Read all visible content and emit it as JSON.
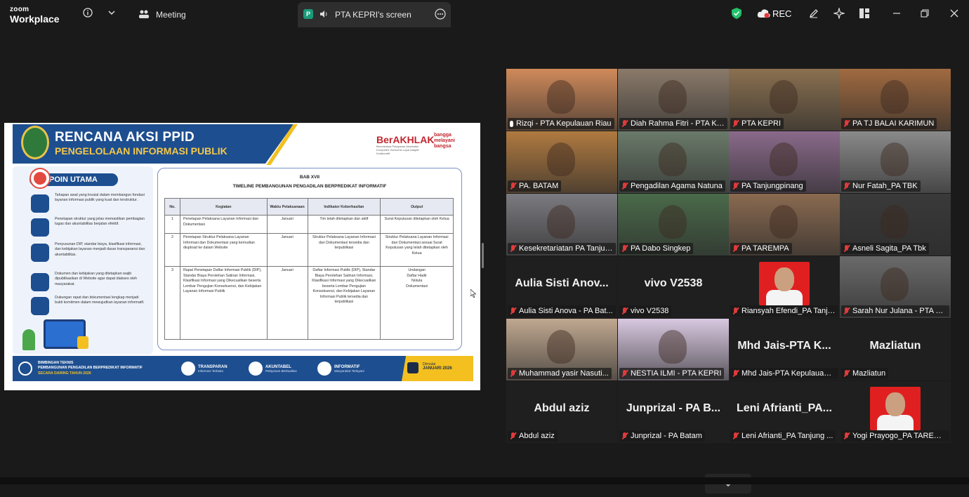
{
  "app": {
    "brand_small": "zoom",
    "brand_big": "Workplace",
    "meeting_label": "Meeting",
    "share_label": "PTA KEPRI's screen",
    "share_badge": "P",
    "rec_label": "REC"
  },
  "slide": {
    "title1": "RENCANA AKSI PPID",
    "title2": "PENGELOLAAN INFORMASI PUBLIK",
    "berakhlak": "BerAKHLAK",
    "berakhlak_sub": "Berorientasi Pelayanan Akuntabel Kompeten Harmonis Loyal Adaptif Kolaboratif",
    "bangga": "bangga melayani bangsa",
    "poin_title": "POIN UTAMA",
    "poin_items": [
      "Tahapan awal yang krusial dalam membangun fondasi layanan informasi publik yang kuat dan terstruktur.",
      "Penetapan struktur yang jelas memastikan pembagian tugas dan akuntabilitas berjalan efektif.",
      "Penyusunan DIP, standar biaya, klasifikasi informasi, dan kebijakan layanan menjadi dasar transparansi dan akuntabilitas.",
      "Dokumen dan kebijakan yang ditetapkan wajib dipublikasikan di Website agar dapat diakses oleh masyarakat.",
      "Dukungan rapat dan dokumentasi lengkap menjadi bukti komitmen dalam mewujudkan layanan informatif."
    ],
    "bab": "BAB XVII",
    "timeline_title": "TIMELINE PEMBANGUNAN PENGADILAN BERPREDIKAT INFORMATIF",
    "headers": [
      "No.",
      "Kegiatan",
      "Waktu Pelaksanaan",
      "Indikator Keberhasilan",
      "Output"
    ],
    "rows": [
      {
        "no": "1",
        "kegiatan": "Penetapan Pelaksana Layanan Informasi dan Dokumentasi",
        "waktu": "Januari",
        "indikator": "Tim telah ditetapkan dan aktif",
        "output": "Surat Keputusan ditetapkan oleh Ketua"
      },
      {
        "no": "2",
        "kegiatan": "Penetapan Struktur Pelaksana Layanan Informasi dan Dokumentasi yang kemudian diupload ke dalam Website",
        "waktu": "Januari",
        "indikator": "Struktur Pelaksana Layanan Informasi dan Dokumentasi tersedia dan terpublikasi",
        "output": "Struktur Pelaksana Layanan Informasi dan Dokumentasi sesuai Surat Keputusan yang telah ditetapkan oleh Ketua"
      },
      {
        "no": "3",
        "kegiatan": "Rapat Penetapan Daftar Informasi Publik (DIP), Standar Biaya Perolehan Salinan Informasi, Klasifikasi Informasi yang Dikecualikan beserta Lembar Pengujian Konsekuensi, dan Kebijakan Layanan Informasi Publik",
        "waktu": "Januari",
        "indikator": "Daftar Informasi Publik (DIP), Standar Biaya Perolehan Salinan Informasi, Klasifikasi Informasi yang Dikecualikan beserta Lembar Pengujian Konsekuensi, dan Kebijakan Layanan Informasi Publik tersedia dan terpublikasi",
        "output": "Undangan\nDaftar Hadir\nNotula\nDokumentasi"
      }
    ],
    "footer": {
      "bimtek1": "BIMBINGAN TEKNIS",
      "bimtek2": "PEMBANGUNAN PENGADILAN BERPREDIKAT INFORMATIF",
      "bimtek3": "SECARA DARING TAHUN 2026",
      "chips": [
        {
          "t1": "TRANSPARAN",
          "t2": "Informasi Terbuka"
        },
        {
          "t1": "AKUNTABEL",
          "t2": "Pelayanan Berkualitas"
        },
        {
          "t1": "INFORMATIF",
          "t2": "Masyarakat Terlayani"
        }
      ],
      "dimulai": "Dimulai",
      "dimulai_date": "JANUARI 2026"
    }
  },
  "participants": [
    {
      "name": "Rizqi - PTA Kepulauan Riau",
      "big": "",
      "kind": "video",
      "color": "#d08a5a",
      "muted": false,
      "active": true
    },
    {
      "name": "Diah Rahma Fitri - PTA Ke...",
      "big": "",
      "kind": "video",
      "color": "#8a7a6a",
      "muted": true
    },
    {
      "name": "PTA KEPRI",
      "big": "",
      "kind": "video",
      "color": "#8a7050",
      "muted": true
    },
    {
      "name": "PA TJ BALAI KARIMUN",
      "big": "",
      "kind": "video",
      "color": "#a06a40",
      "muted": true
    },
    {
      "name": "PA. BATAM",
      "big": "",
      "kind": "video",
      "color": "#b07a40",
      "muted": true
    },
    {
      "name": "Pengadilan Agama Natuna",
      "big": "",
      "kind": "video",
      "color": "#6a7a6a",
      "muted": true
    },
    {
      "name": "PA Tanjungpinang",
      "big": "",
      "kind": "video",
      "color": "#8a6a8a",
      "muted": true
    },
    {
      "name": "Nur Fatah_PA TBK",
      "big": "",
      "kind": "video",
      "color": "#8a8a8a",
      "muted": true
    },
    {
      "name": "Kesekretariatan PA Tanjun...",
      "big": "",
      "kind": "video",
      "color": "#7a7a80",
      "muted": true
    },
    {
      "name": "PA Dabo Singkep",
      "big": "",
      "kind": "video",
      "color": "#4a6a4a",
      "muted": true
    },
    {
      "name": "PA TAREMPA",
      "big": "",
      "kind": "video",
      "color": "#8a6a50",
      "muted": true
    },
    {
      "name": "Asneli Sagita_PA Tbk",
      "big": "",
      "kind": "video",
      "color": "#3a3a3a",
      "muted": true
    },
    {
      "name": "Aulia Sisti Anova - PA Bat...",
      "big": "Aulia Sisti Anov...",
      "kind": "text",
      "muted": true
    },
    {
      "name": "vivo V2538",
      "big": "vivo V2538",
      "kind": "text",
      "muted": true
    },
    {
      "name": "Riansyah Efendi_PA Tanju...",
      "big": "",
      "kind": "photo",
      "color": "#e02020",
      "muted": true
    },
    {
      "name": "Sarah Nur Julana - PTA K...",
      "big": "",
      "kind": "video",
      "color": "#6a6a6a",
      "muted": true
    },
    {
      "name": "Muhammad yasir Nasuti...",
      "big": "",
      "kind": "video",
      "color": "#c0a890",
      "muted": true
    },
    {
      "name": "NESTIA ILMI - PTA KEPRI",
      "big": "",
      "kind": "video",
      "color": "#d8c8e0",
      "muted": true
    },
    {
      "name": "Mhd Jais-PTA Kepulauan ...",
      "big": "Mhd Jais-PTA K...",
      "kind": "text",
      "muted": true
    },
    {
      "name": "Mazliatun",
      "big": "Mazliatun",
      "kind": "text",
      "muted": true
    },
    {
      "name": "Abdul aziz",
      "big": "Abdul aziz",
      "kind": "text",
      "muted": true
    },
    {
      "name": "Junprizal - PA Batam",
      "big": "Junprizal - PA B...",
      "kind": "text",
      "muted": true
    },
    {
      "name": "Leni Afrianti_PA Tanjung ...",
      "big": "Leni Afrianti_PA...",
      "kind": "text",
      "muted": true
    },
    {
      "name": "Yogi Prayogo_PA TAREMPA",
      "big": "",
      "kind": "photo",
      "color": "#e02020",
      "muted": true
    }
  ]
}
